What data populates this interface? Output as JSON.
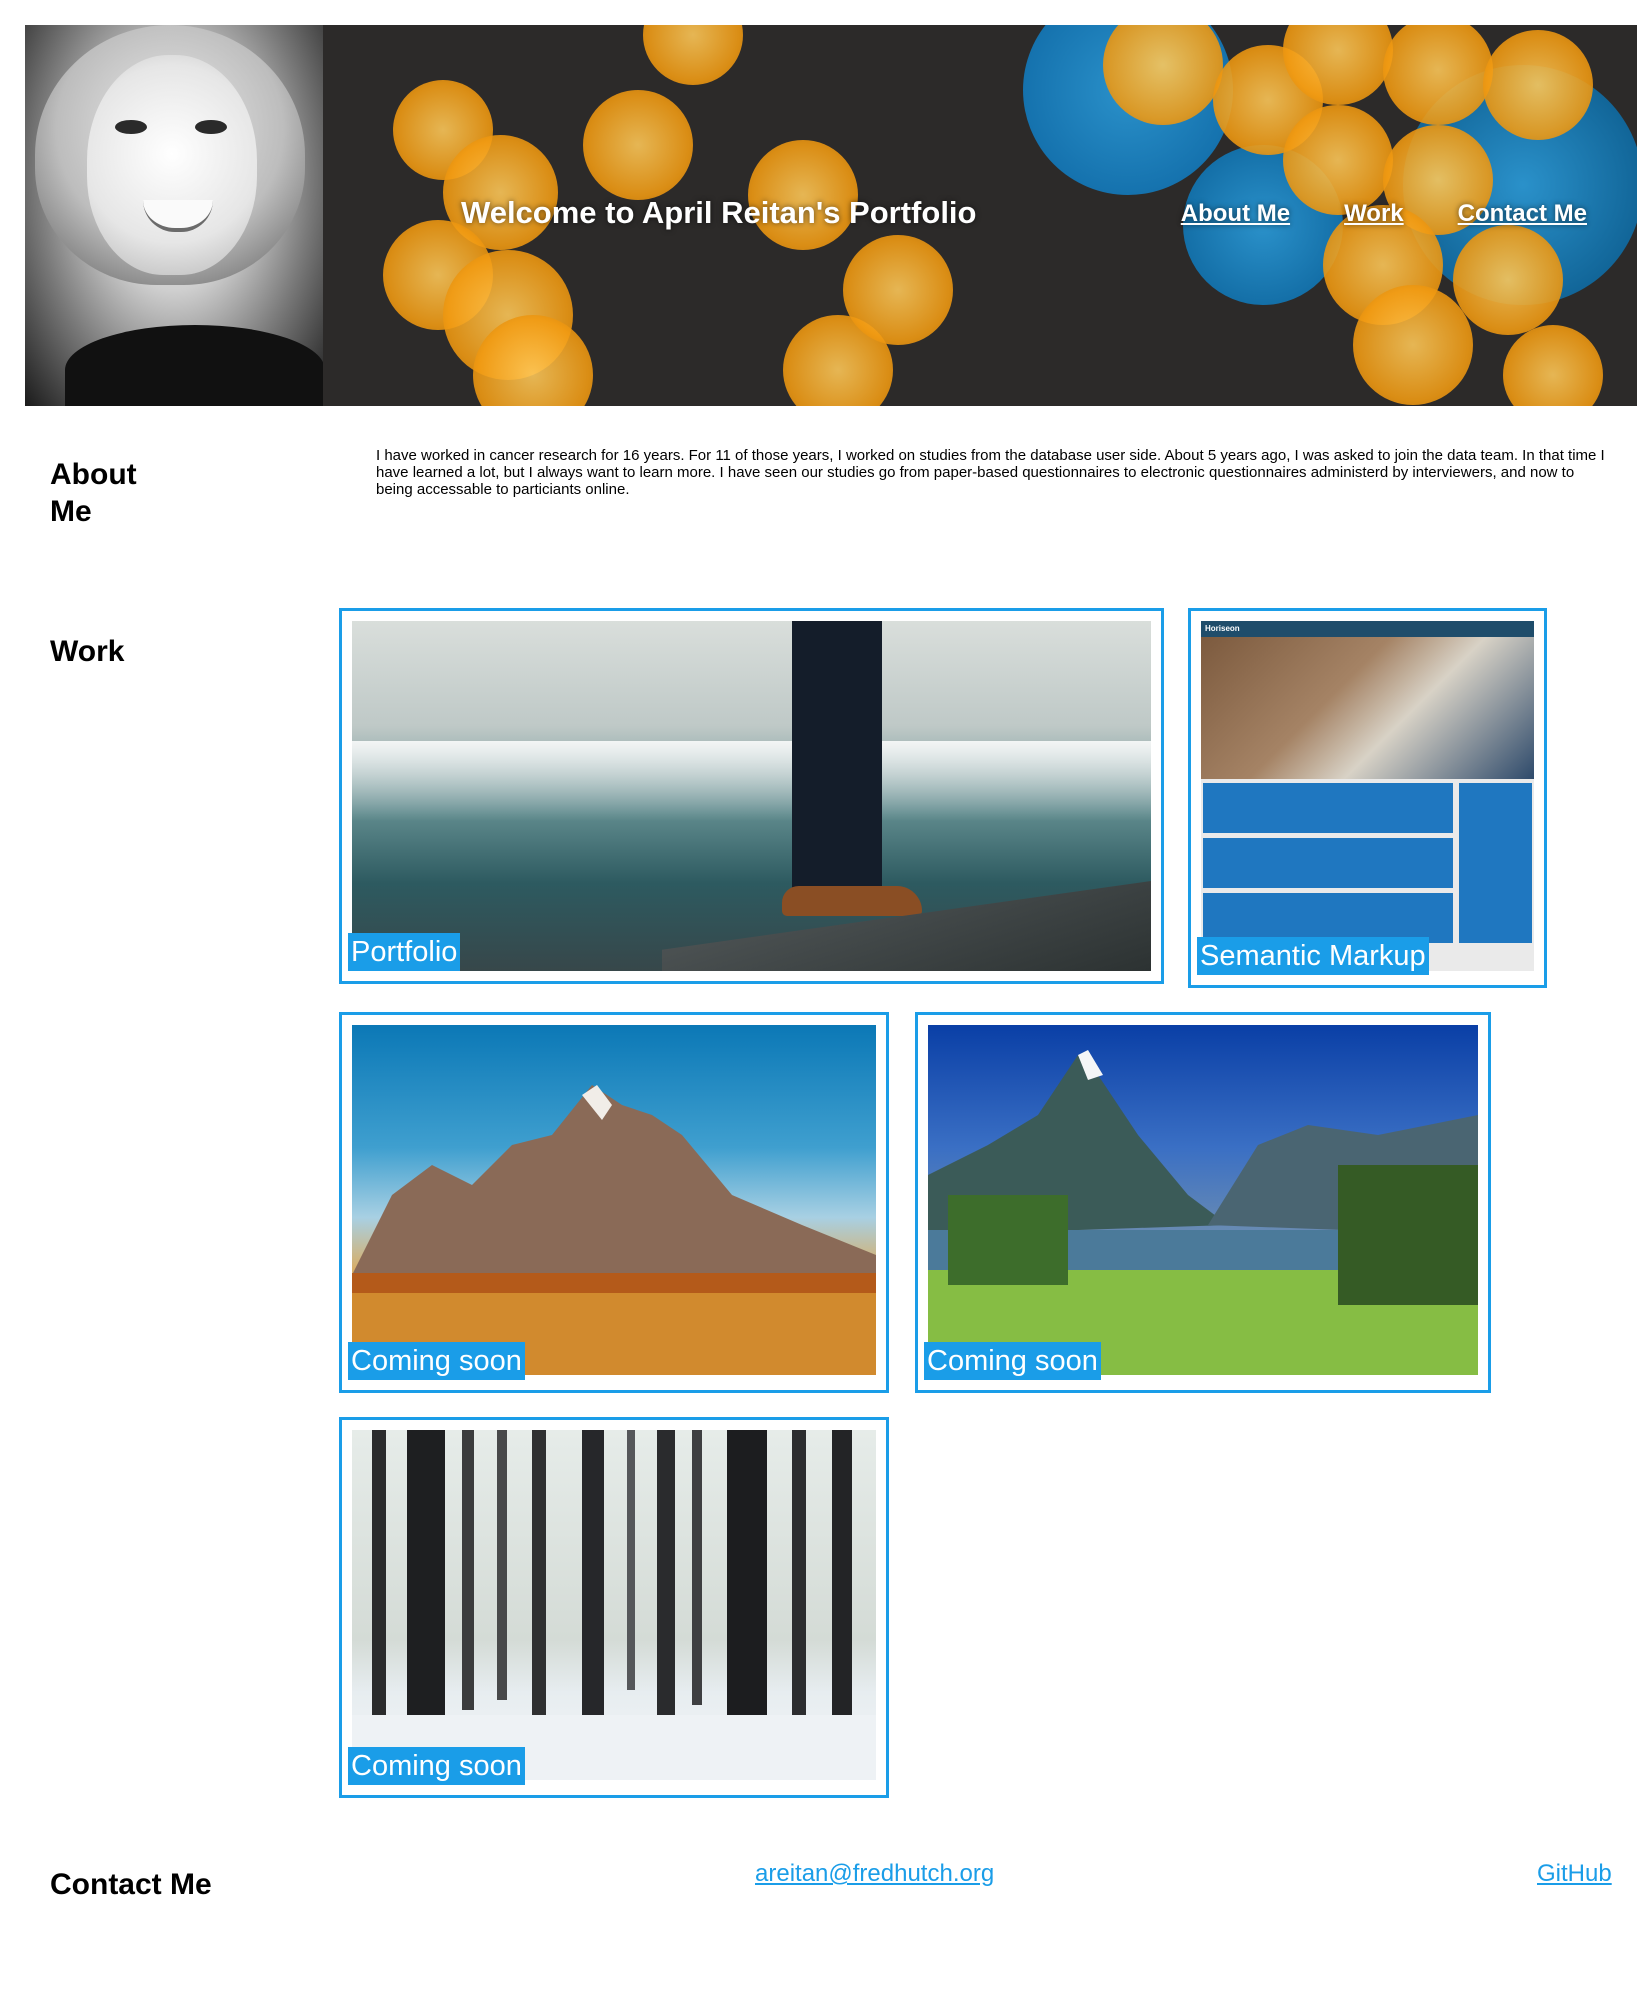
{
  "header": {
    "welcome_text": "Welcome to April Reitan's Portfolio",
    "nav": [
      "About Me",
      "Work",
      "Contact Me"
    ]
  },
  "about": {
    "heading": "About Me",
    "text": "I have worked in cancer research for 16 years. For 11 of those years, I worked on studies from the database user side. About 5 years ago, I was asked to join the data team. In that time I have learned a lot, but I always want to learn more. I have seen our studies go from paper-based questionnaires to electronic questionnaires administerd by interviewers, and now to being accessable to particiants online."
  },
  "work": {
    "heading": "Work",
    "projects": [
      {
        "caption": "Portfolio"
      },
      {
        "caption": "Semantic Markup"
      },
      {
        "caption": "Coming soon"
      },
      {
        "caption": "Coming soon"
      },
      {
        "caption": "Coming soon"
      }
    ]
  },
  "contact": {
    "heading": "Contact Me",
    "email": "areitan@fredhutch.org",
    "github": "GitHub"
  },
  "colors": {
    "accent": "#1a9de8",
    "banner_bg": "#2c2a29",
    "bokeh_orange": "#f7a21c",
    "bokeh_blue": "#1b8fd4"
  }
}
